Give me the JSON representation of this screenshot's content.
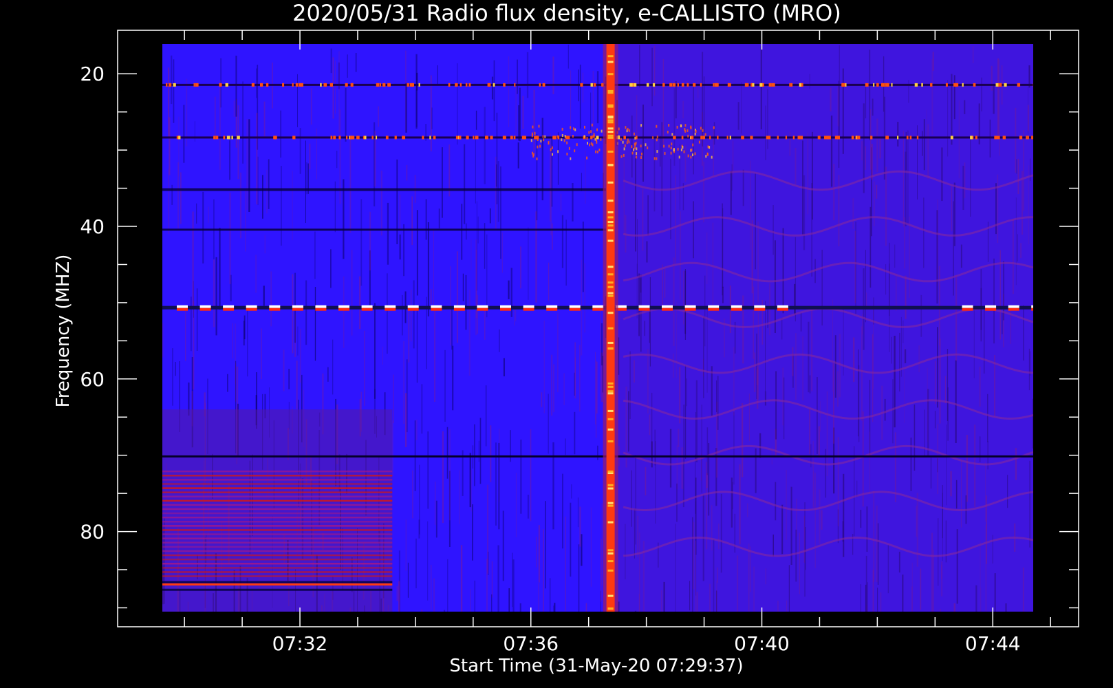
{
  "chart_data": {
    "type": "heatmap",
    "title": "2020/05/31  Radio flux density, e-CALLISTO (MRO)",
    "xlabel": "Start Time (31-May-20 07:29:37)",
    "ylabel": "Frequency (MHZ)",
    "x_ticks": [
      "07:32",
      "07:36",
      "07:40",
      "07:44"
    ],
    "x_tick_minutes": [
      32,
      36,
      40,
      44
    ],
    "x_range_minutes": [
      29.617,
      45.0
    ],
    "y_ticks": [
      20,
      40,
      60,
      80
    ],
    "y_range_mhz": [
      16.1,
      90.7
    ],
    "y_axis_inverted": true,
    "data_extent_minutes": [
      29.617,
      44.7
    ],
    "data_extent_mhz": [
      16.1,
      90.5
    ],
    "colormap": [
      "#000000",
      "#1a0078",
      "#2f14ff",
      "#8a1a8a",
      "#d11818",
      "#ff6a00",
      "#ffd040",
      "#ffffff"
    ],
    "features": [
      {
        "label": "broadband burst",
        "time_minutes": 37.38,
        "freq_mhz": [
          16.1,
          90.5
        ]
      },
      {
        "label": "interference band",
        "freq_mhz": 21.5
      },
      {
        "label": "interference band",
        "freq_mhz": 28.4
      },
      {
        "label": "interference band",
        "freq_mhz": 50.7
      },
      {
        "label": "interference band",
        "freq_mhz": 70.2
      },
      {
        "label": "elevated low-frequency segment",
        "time_minutes": [
          29.617,
          33.6
        ],
        "freq_mhz": [
          72.0,
          86.0
        ]
      }
    ],
    "grid": false,
    "legend": "none"
  },
  "colors": {
    "background": "#000000",
    "axes": "#ffffff",
    "base_intensity": "#2f14ff",
    "burst": "#ff3a10",
    "hot": "#ffffff"
  }
}
